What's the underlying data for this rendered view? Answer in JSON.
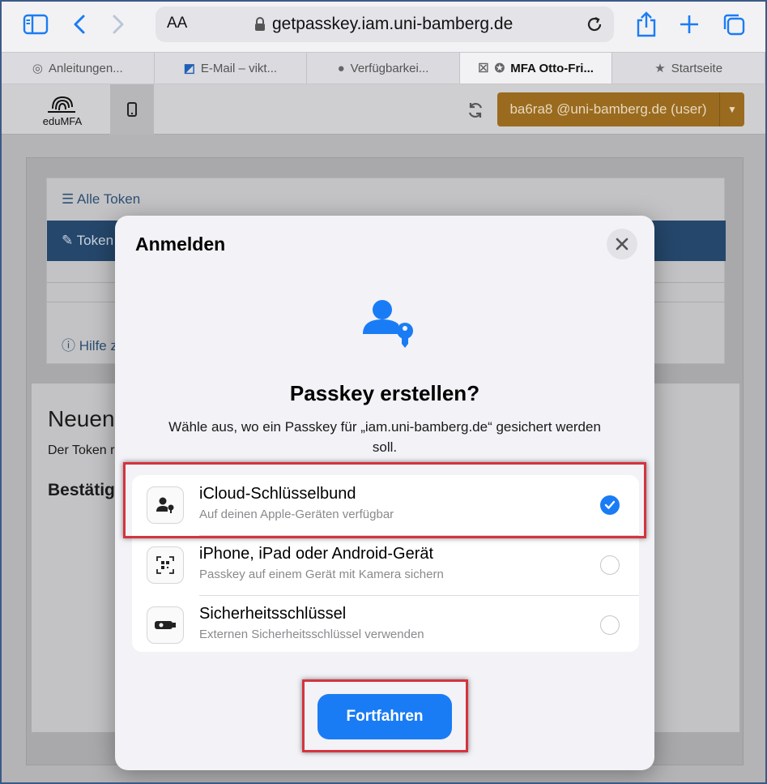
{
  "browser": {
    "aa_label": "AA",
    "url": "getpasskey.iam.uni-bamberg.de",
    "icons": [
      "sidebar-icon",
      "back-icon",
      "forward-icon",
      "lock-icon",
      "reload-icon",
      "share-icon",
      "new-tab-icon",
      "tabs-overview-icon"
    ],
    "tabs": [
      {
        "label": "Anleitungen...",
        "icon": "spiral-icon"
      },
      {
        "label": "E-Mail – vikt...",
        "icon": "outlook-icon"
      },
      {
        "label": "Verfügbarkei...",
        "icon": "apple-icon"
      },
      {
        "label": "MFA Otto-Fri...",
        "icon": "mfa-icon",
        "active": true
      },
      {
        "label": "Startseite",
        "icon": "star-icon"
      }
    ]
  },
  "app": {
    "logo_text": "eduMFA",
    "user_button": "ba6ra8 @uni-bamberg.de (user)",
    "alle_token": "Alle Token",
    "token_bar": "Token",
    "hilfe": "Hilfe z",
    "neuen": "Neuen",
    "der_token": "Der Token r",
    "bestatig": "Bestätig"
  },
  "modal": {
    "title": "Anmelden",
    "heading": "Passkey erstellen?",
    "description": "Wähle aus, wo ein Passkey für „iam.uni-bamberg.de“ gesichert werden soll.",
    "options": [
      {
        "title": "iCloud-Schlüsselbund",
        "subtitle": "Auf deinen Apple-Geräten verfügbar",
        "selected": true,
        "icon": "person-key-icon"
      },
      {
        "title": "iPhone, iPad oder Android-Gerät",
        "subtitle": "Passkey auf einem Gerät mit Kamera sichern",
        "selected": false,
        "icon": "qr-code-icon"
      },
      {
        "title": "Sicherheitsschlüssel",
        "subtitle": "Externen Sicherheitsschlüssel verwenden",
        "selected": false,
        "icon": "security-key-icon"
      }
    ],
    "continue_button": "Fortfahren"
  },
  "colors": {
    "accent": "#1a7cf5",
    "highlight": "#d4343d",
    "user_button": "#9a6b1e"
  }
}
